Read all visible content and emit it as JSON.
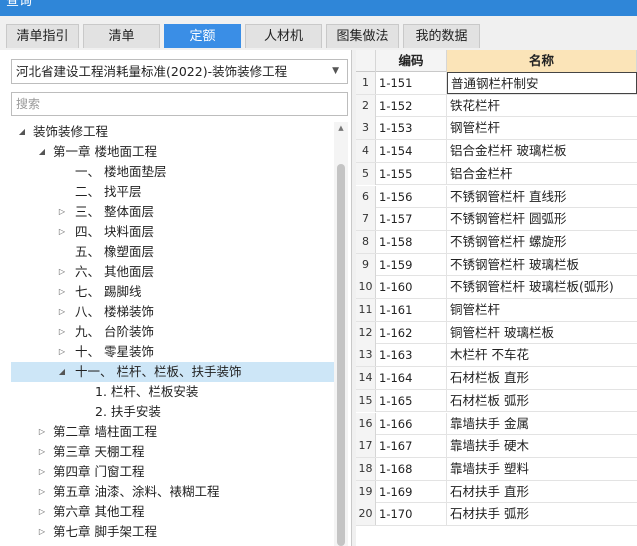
{
  "window": {
    "title": "查询"
  },
  "tabs": [
    {
      "label": "清单指引",
      "active": false
    },
    {
      "label": "清单",
      "active": false
    },
    {
      "label": "定额",
      "active": true
    },
    {
      "label": "人材机",
      "active": false
    },
    {
      "label": "图集做法",
      "active": false
    },
    {
      "label": "我的数据",
      "active": false
    }
  ],
  "quota_library": {
    "selected": "河北省建设工程消耗量标准(2022)-装饰装修工程"
  },
  "search": {
    "placeholder": "搜索"
  },
  "tree": [
    {
      "arrow": "◢",
      "label": "装饰装修工程"
    },
    {
      "arrow": "◢",
      "label": "第一章 楼地面工程"
    },
    {
      "arrow": "",
      "label": "一、 楼地面垫层"
    },
    {
      "arrow": "",
      "label": "二、 找平层"
    },
    {
      "arrow": "▷",
      "label": "三、 整体面层"
    },
    {
      "arrow": "▷",
      "label": "四、 块料面层"
    },
    {
      "arrow": "",
      "label": "五、 橡塑面层"
    },
    {
      "arrow": "▷",
      "label": "六、 其他面层"
    },
    {
      "arrow": "▷",
      "label": "七、 踢脚线"
    },
    {
      "arrow": "▷",
      "label": "八、 楼梯装饰"
    },
    {
      "arrow": "▷",
      "label": "九、 台阶装饰"
    },
    {
      "arrow": "▷",
      "label": "十、 零星装饰"
    },
    {
      "arrow": "◢",
      "label": "十一、 栏杆、栏板、扶手装饰",
      "selected": true
    },
    {
      "arrow": "",
      "label": "1. 栏杆、栏板安装"
    },
    {
      "arrow": "",
      "label": "2. 扶手安装"
    },
    {
      "arrow": "▷",
      "label": "第二章 墙柱面工程"
    },
    {
      "arrow": "▷",
      "label": "第三章 天棚工程"
    },
    {
      "arrow": "▷",
      "label": "第四章 门窗工程"
    },
    {
      "arrow": "▷",
      "label": "第五章 油漆、涂料、裱糊工程"
    },
    {
      "arrow": "▷",
      "label": "第六章 其他工程"
    },
    {
      "arrow": "▷",
      "label": "第七章 脚手架工程"
    }
  ],
  "grid": {
    "headers": {
      "code": "编码",
      "name": "名称"
    },
    "rows": [
      {
        "n": "1",
        "code": "1-151",
        "name": "普通钢栏杆制安"
      },
      {
        "n": "2",
        "code": "1-152",
        "name": "铁花栏杆"
      },
      {
        "n": "3",
        "code": "1-153",
        "name": "钢管栏杆"
      },
      {
        "n": "4",
        "code": "1-154",
        "name": "铝合金栏杆 玻璃栏板"
      },
      {
        "n": "5",
        "code": "1-155",
        "name": "铝合金栏杆"
      },
      {
        "n": "6",
        "code": "1-156",
        "name": "不锈钢管栏杆 直线形"
      },
      {
        "n": "7",
        "code": "1-157",
        "name": "不锈钢管栏杆 圆弧形"
      },
      {
        "n": "8",
        "code": "1-158",
        "name": "不锈钢管栏杆 螺旋形"
      },
      {
        "n": "9",
        "code": "1-159",
        "name": "不锈钢管栏杆 玻璃栏板"
      },
      {
        "n": "10",
        "code": "1-160",
        "name": "不锈钢管栏杆 玻璃栏板(弧形)"
      },
      {
        "n": "11",
        "code": "1-161",
        "name": "铜管栏杆"
      },
      {
        "n": "12",
        "code": "1-162",
        "name": "铜管栏杆 玻璃栏板"
      },
      {
        "n": "13",
        "code": "1-163",
        "name": "木栏杆 不车花"
      },
      {
        "n": "14",
        "code": "1-164",
        "name": "石材栏板 直形"
      },
      {
        "n": "15",
        "code": "1-165",
        "name": "石材栏板 弧形"
      },
      {
        "n": "16",
        "code": "1-166",
        "name": "靠墙扶手 金属"
      },
      {
        "n": "17",
        "code": "1-167",
        "name": "靠墙扶手 硬木"
      },
      {
        "n": "18",
        "code": "1-168",
        "name": "靠墙扶手 塑料"
      },
      {
        "n": "19",
        "code": "1-169",
        "name": "石材扶手 直形"
      },
      {
        "n": "20",
        "code": "1-170",
        "name": "石材扶手 弧形"
      }
    ]
  }
}
